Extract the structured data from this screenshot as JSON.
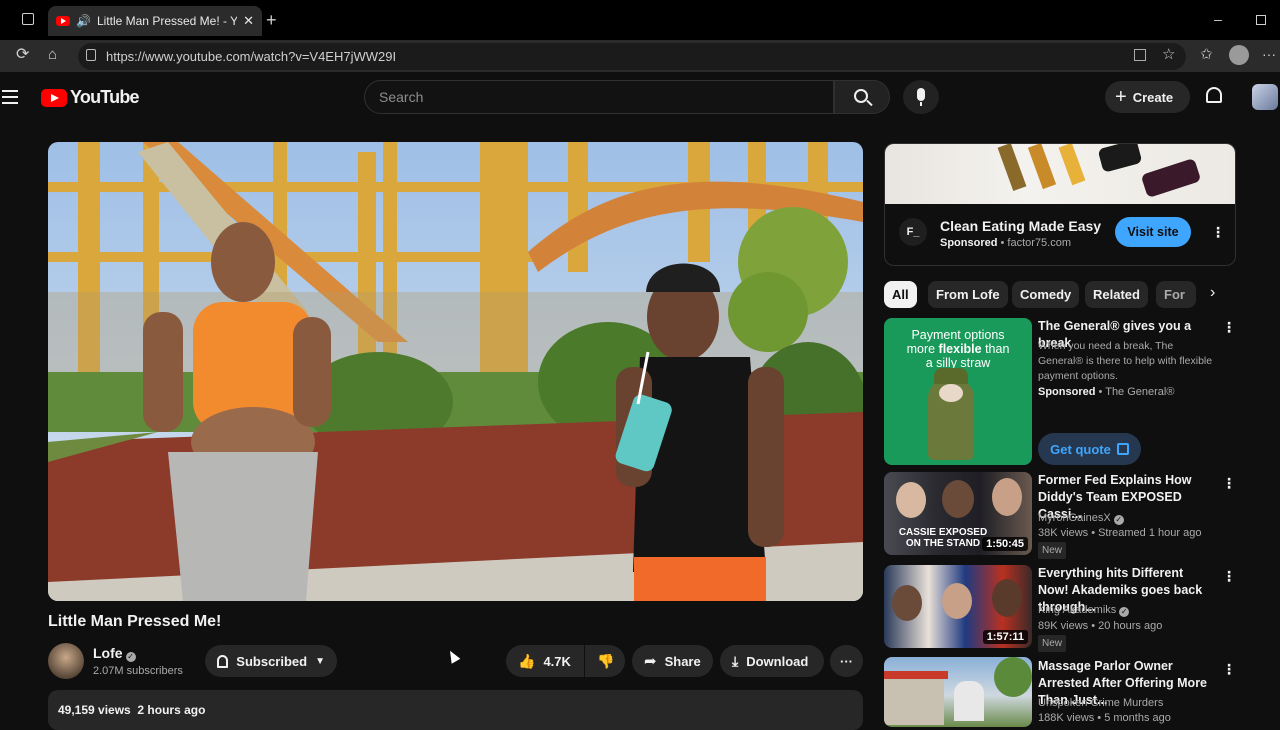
{
  "browser": {
    "tab_title": "Little Man Pressed Me! - YouTube",
    "url": "https://www.youtube.com/watch?v=V4EH7jWW29I"
  },
  "youtube": {
    "logo_text": "YouTube",
    "search_placeholder": "Search",
    "create_label": "Create"
  },
  "video": {
    "title": "Little Man Pressed Me!",
    "channel": "Lofe",
    "subscribers": "2.07M subscribers",
    "subscribed_label": "Subscribed",
    "likes": "4.7K",
    "share_label": "Share",
    "download_label": "Download",
    "views": "49,159 views",
    "posted": "2 hours ago"
  },
  "ad": {
    "logo_text": "F_",
    "headline": "Clean Eating Made Easy",
    "sponsored": "Sponsored",
    "domain": "factor75.com",
    "cta": "Visit site"
  },
  "chips": [
    "All",
    "From Lofe",
    "Comedy",
    "Related",
    "For y"
  ],
  "ad2": {
    "thumb_line1": "Payment options",
    "thumb_line2_pre": "more ",
    "thumb_line2_bold": "flexible",
    "thumb_line2_post": " than",
    "thumb_line3": "a silly straw",
    "title": "The General® gives you a break",
    "desc": "When you need a break, The General® is there to help with flexible payment options.",
    "sponsored": "Sponsored",
    "advertiser": "The General®",
    "cta": "Get quote"
  },
  "recommendations": [
    {
      "title": "Former Fed Explains How Diddy's Team EXPOSED Cassi...",
      "channel": "MyronGainesX",
      "meta": "38K views • Streamed 1 hour ago",
      "badge": "New",
      "duration": "1:50:45",
      "thumb_text": "CASSIE EXPOSED ON THE STAND"
    },
    {
      "title": "Everything hits Different Now! Akademiks goes back through...",
      "channel": "King Akademiks",
      "meta": "89K views • 20 hours ago",
      "badge": "New",
      "duration": "1:57:11"
    },
    {
      "title": "Massage Parlor Owner Arrested After Offering More Than Just...",
      "channel": "Unspoken Crime Murders",
      "meta": "188K views • 5 months ago"
    }
  ]
}
